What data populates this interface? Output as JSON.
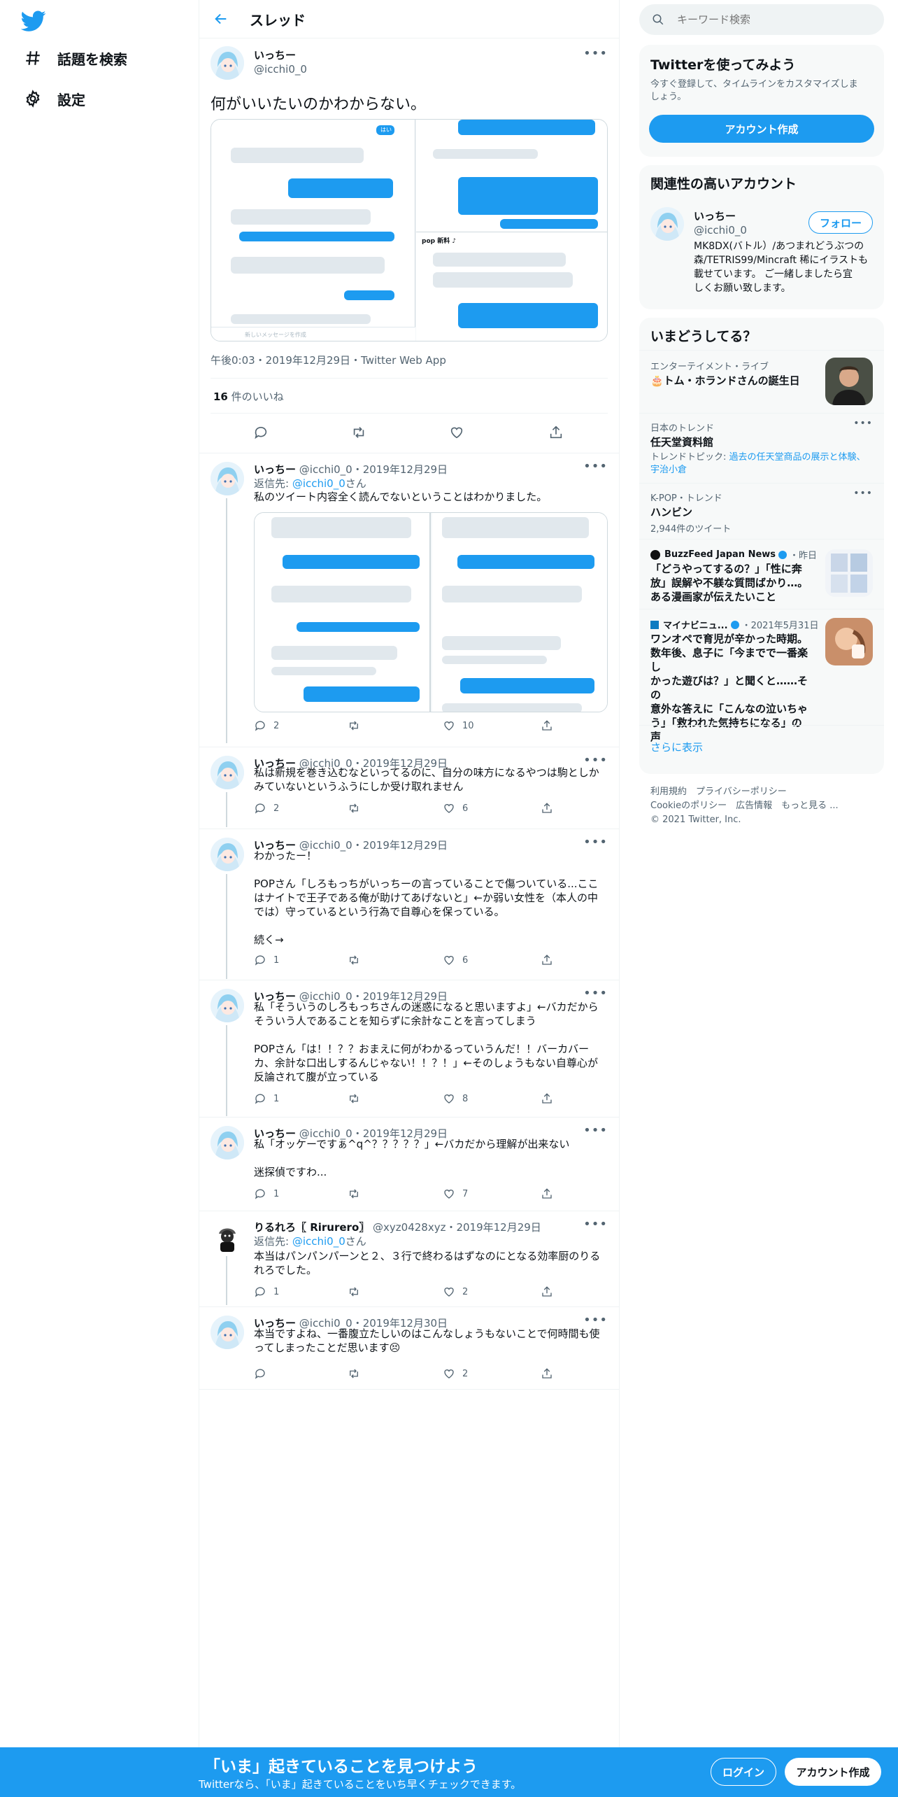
{
  "nav": {
    "explore_label": "話題を検索",
    "settings_label": "設定"
  },
  "header": {
    "title": "スレッド"
  },
  "focus_tweet": {
    "name": "いっちー",
    "handle": "@icchi0_0",
    "text": "何がいいたいのかわからない。",
    "meta": "午後0:03・2019年12月29日・Twitter Web App",
    "likes_count": "16",
    "likes_label": " 件のいいね",
    "media_chat_labels": [
      "はい",
      "pop 新料 ♪"
    ],
    "media_input_placeholder": "新しいメッセージを作成"
  },
  "replies": [
    {
      "name": "いっちー",
      "rest": " @icchi0_0・2019年12月29日",
      "reply_to_prefix": "返信先: ",
      "reply_to": "@icchi0_0",
      "reply_to_suffix": "さん",
      "text": "私のツイート内容全く読んでないということはわかりました。",
      "replies": "2",
      "retweets": "",
      "likes": "10"
    },
    {
      "name": "いっちー",
      "rest": " @icchi0_0・2019年12月29日",
      "text": "私は新規を巻き込むなといってるのに、自分の味方になるやつは駒としか\nみていないというふうにしか受け取れません",
      "replies": "2",
      "retweets": "",
      "likes": "6"
    },
    {
      "name": "いっちー",
      "rest": " @icchi0_0・2019年12月29日",
      "text": "わかったー！\n\nPOPさん「しろもっちがいっちーの言っていることで傷ついている...ここ\nはナイトで王子である俺が助けてあげないと」←か弱い女性を（本人の中\nでは）守っているという行為で自尊心を保っている。\n\n続く→",
      "replies": "1",
      "retweets": "",
      "likes": "6"
    },
    {
      "name": "いっちー",
      "rest": " @icchi0_0・2019年12月29日",
      "text": "私「そういうのしろもっちさんの迷惑になると思いますよ」←バカだから\nそういう人であることを知らずに余計なことを言ってしまう\n\nPOPさん「は！！？？おまえに何がわかるっていうんだ！！バーカバー\nカ、余計な口出しするんじゃない！！？！」←そのしょうもない自尊心が\n反論されて腹が立っている",
      "replies": "1",
      "retweets": "",
      "likes": "8"
    },
    {
      "name": "いっちー",
      "rest": " @icchi0_0・2019年12月29日",
      "text": "私「オッケーですぁ^q^？？？？？」←バカだから理解が出来ない\n\n迷探偵ですわ...",
      "replies": "1",
      "retweets": "",
      "likes": "7"
    },
    {
      "name": "りるれろ〖 Rirurero〗",
      "rest": " @xyz0428xyz・2019年12月29日",
      "reply_to_prefix": "返信先: ",
      "reply_to": "@icchi0_0",
      "reply_to_suffix": "さん",
      "text": "本当はパンパンパーンと２、３行で終わるはずなのにとなる効率厨のりる\nれろでした。",
      "replies": "1",
      "retweets": "",
      "likes": "2"
    },
    {
      "name": "いっちー",
      "rest": " @icchi0_0・2019年12月30日",
      "text": "本当ですよね、一番腹立たしいのはこんなしょうもないことで何時間も使\nってしまったことだ思います😣",
      "replies": "",
      "retweets": "",
      "likes": "2"
    }
  ],
  "search": {
    "placeholder": "キーワード検索"
  },
  "signup_card": {
    "title": "Twitterを使ってみよう",
    "desc": "今すぐ登録して、タイムラインをカスタマイズしま\nしょう。",
    "button": "アカウント作成"
  },
  "related": {
    "title": "関連性の高いアカウント",
    "name": "いっちー",
    "handle": "@icchi0_0",
    "follow": "フォロー",
    "bio": "MK8DX(バトル）/あつまれどうぶつの\n森/TETRIS99/Mincraft 稀にイラストも\n載せています。 ご一緒しましたら宜\nしくお願い致します。"
  },
  "trends": {
    "title": "いまどうしてる？",
    "items": [
      {
        "context": "エンターテイメント・ライブ",
        "title": "🎂トム・ホランドさんの誕生日"
      },
      {
        "context": "日本のトレンド",
        "title": "任天堂資料館",
        "sub_prefix": "トレンドトピック: ",
        "sub_link": "過去の任天堂商品の展示と体験、\n宇治小倉"
      },
      {
        "context": "K-POP・トレンド",
        "title": "ハンビン",
        "count": "2,944件のツイート"
      },
      {
        "source": "BuzzFeed Japan News",
        "time": "・昨日",
        "title": "「どうやってするの？」「性に奔\n放」誤解や不躾な質問ばかり…。\nある漫画家が伝えたいこと"
      },
      {
        "source": "マイナビニュ...",
        "time": "・2021年5月31日",
        "title": "ワンオペで育児が辛かった時期。\n数年後、息子に「今までで一番楽し\nかった遊びは？」と聞くと……その\n意外な答えに「こんなの泣いちゃ\nう」「救われた気持ちになる」の\n声"
      }
    ],
    "more": "さらに表示"
  },
  "footer": {
    "line1": "利用規約　プライバシーポリシー",
    "line2": "Cookieのポリシー　広告情報　もっと見る ...",
    "line3": "© 2021 Twitter, Inc."
  },
  "bottom_bar": {
    "title": "「いま」起きていることを見つけよう",
    "subtitle": "Twitterなら、「いま」起きていることをいち早くチェックできます。",
    "login": "ログイン",
    "signup": "アカウント作成"
  },
  "colors": {
    "accent": "#1d9bf0",
    "text": "#0f1419",
    "muted": "#536471",
    "border": "#eff3f4"
  }
}
